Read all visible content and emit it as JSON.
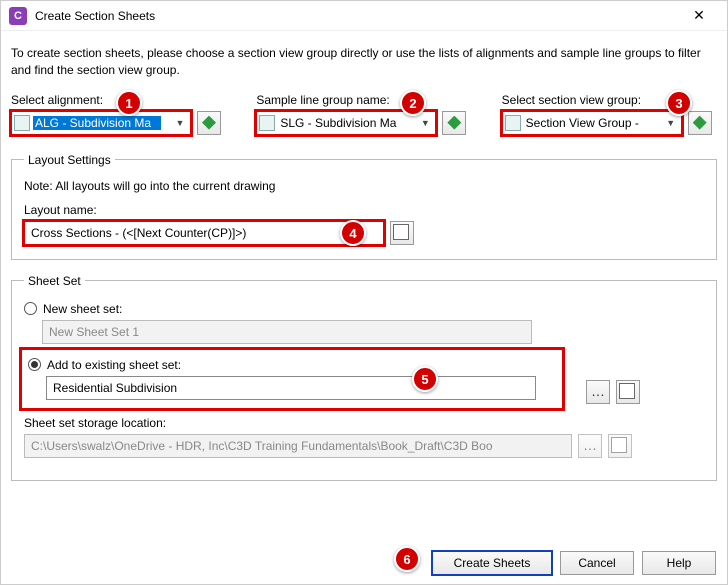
{
  "window": {
    "title": "Create Section Sheets",
    "app_icon_letter": "C"
  },
  "intro": "To create section sheets, please choose a section view group directly or use the lists of alignments and sample line groups to filter and find the section view group.",
  "selectors": {
    "alignment": {
      "label": "Select alignment:",
      "value": "ALG - Subdivision Ma"
    },
    "sample_line": {
      "label": "Sample line group name:",
      "value": "SLG - Subdivision Ma"
    },
    "view_group": {
      "label": "Select section view group:",
      "value": "Section View Group -"
    }
  },
  "layout": {
    "legend": "Layout Settings",
    "note": "Note: All layouts will go into the current drawing",
    "name_label": "Layout name:",
    "name_value": "Cross Sections - (<[Next Counter(CP)]>)"
  },
  "sheetset": {
    "legend": "Sheet Set",
    "new_label": "New sheet set:",
    "new_value": "New Sheet Set 1",
    "existing_label": "Add to existing sheet set:",
    "existing_value": "Residential Subdivision",
    "storage_label": "Sheet set storage location:",
    "storage_value": "C:\\Users\\swalz\\OneDrive - HDR, Inc\\C3D Training Fundamentals\\Book_Draft\\C3D Boo"
  },
  "buttons": {
    "create": "Create Sheets",
    "cancel": "Cancel",
    "help": "Help"
  },
  "callouts": [
    "1",
    "2",
    "3",
    "4",
    "5",
    "6"
  ]
}
